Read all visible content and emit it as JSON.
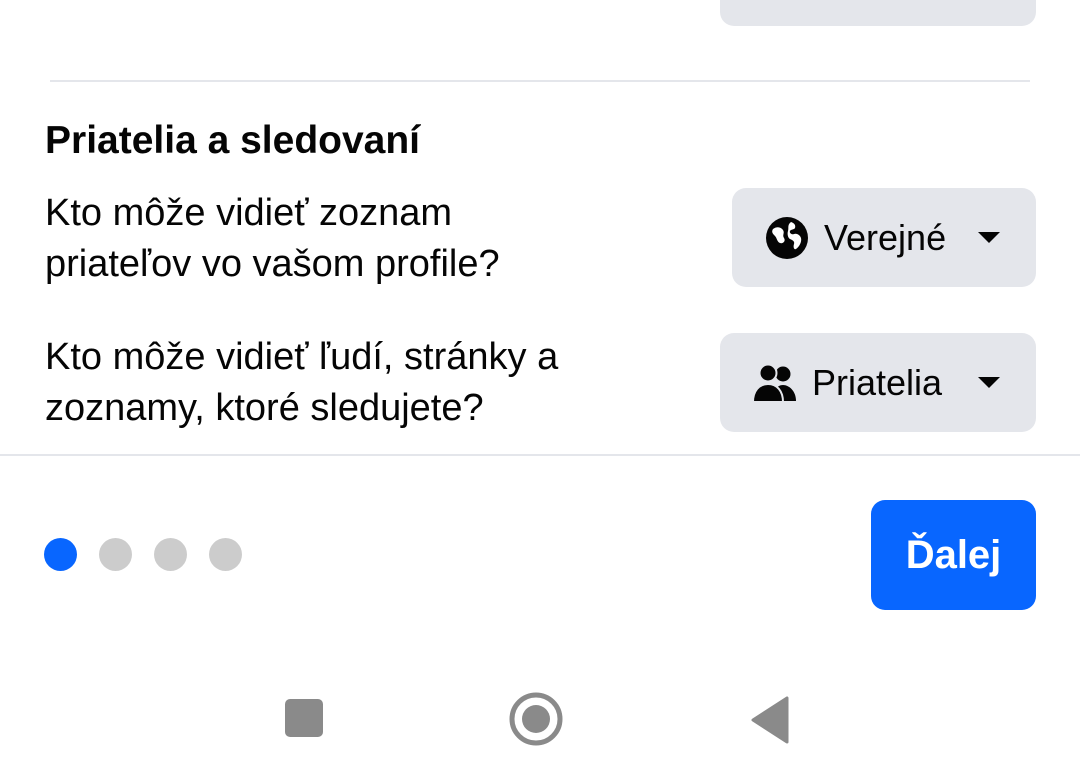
{
  "section": {
    "title": "Priatelia a sledovaní"
  },
  "settings": [
    {
      "question_line1": "Kto môže vidieť zoznam",
      "question_line2": "priateľov vo vašom profile?",
      "value": "Verejné",
      "icon": "globe-icon"
    },
    {
      "question_line1": "Kto môže vidieť ľudí, stránky a",
      "question_line2": "zoznamy, ktoré sledujete?",
      "value": "Priatelia",
      "icon": "friends-icon"
    }
  ],
  "pagination": {
    "total": 4,
    "current": 1
  },
  "footer": {
    "next_label": "Ďalej"
  },
  "colors": {
    "accent": "#0866ff",
    "dropdown_bg": "#e4e6eb",
    "dot_inactive": "#cccccc",
    "nav_icon": "#8a8a8a"
  },
  "navbar": {
    "icons": [
      "recent-apps-icon",
      "home-icon",
      "back-icon"
    ]
  }
}
